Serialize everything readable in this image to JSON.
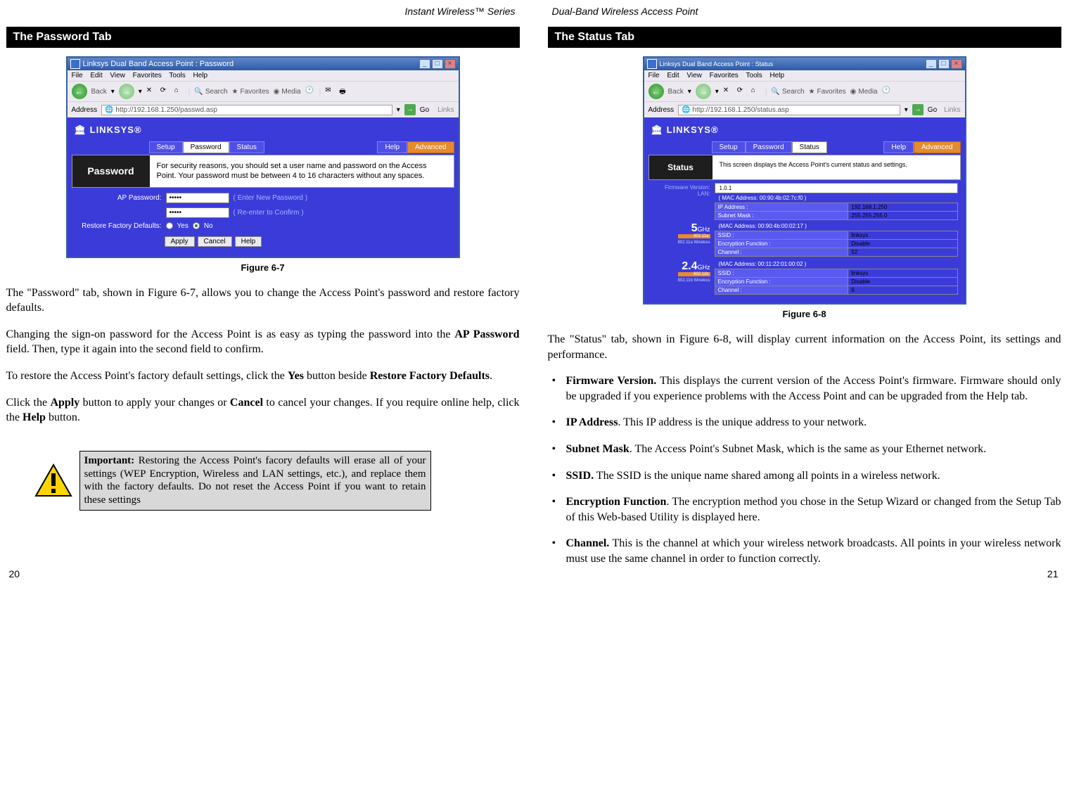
{
  "left_page": {
    "running_head": "Instant Wireless™ Series",
    "section_title": "The Password Tab",
    "figure_caption": "Figure 6-7",
    "page_number": "20",
    "browser": {
      "title": "Linksys Dual Band Access Point : Password",
      "menu": "File   Edit   View   Favorites   Tools   Help",
      "btn_back": "Back",
      "btn_search": "Search",
      "btn_favorites": "Favorites",
      "btn_media": "Media",
      "addr_label": "Address",
      "addr_value": "http://192.168.1.250/passwd.asp",
      "go": "Go",
      "links": "Links",
      "brand": "LINKSYS®",
      "tab_setup": "Setup",
      "tab_password": "Password",
      "tab_status": "Status",
      "tab_help": "Help",
      "tab_advanced": "Advanced",
      "side_label": "Password",
      "desc": "For security reasons, you should set a user name and password on the Access Point. Your password must be between 4 to 16 characters without any spaces.",
      "row_ap_password": "AP Password:",
      "pw_value": "•••••",
      "hint_enter": "( Enter New Password )",
      "hint_confirm": "( Re-enter to Confirm )",
      "row_restore": "Restore Factory Defaults:",
      "radio_yes": "Yes",
      "radio_no": "No",
      "btn_apply": "Apply",
      "btn_cancel": "Cancel",
      "btn_help": "Help"
    },
    "para1a": "The \"Password\" tab, shown in Figure 6-7, allows you to change the Access Point's password and restore factory defaults.",
    "para2_pre": "Changing the sign-on password for the Access Point is as easy as typing the password into the ",
    "para2_bold": "AP Password",
    "para2_post": " field. Then, type it again into the second field to confirm.",
    "para3_pre": "To restore the Access Point's factory default settings, click the ",
    "para3_b1": "Yes",
    "para3_mid": " button beside ",
    "para3_b2": "Restore Factory Defaults",
    "para3_post": ".",
    "para4_pre": "Click the ",
    "para4_b1": "Apply",
    "para4_mid1": " button to apply your changes or ",
    "para4_b2": "Cancel",
    "para4_mid2": " to cancel your changes. If you require online help, click the ",
    "para4_b3": "Help",
    "para4_post": " button.",
    "warn_bold": "Important:",
    "warn_text": " Restoring the Access Point's facory defaults will erase all of your settings (WEP Encryption, Wireless and LAN settings, etc.), and replace them with the factory defaults. Do not reset the Access Point if you want to retain these settings"
  },
  "right_page": {
    "running_head": "Dual-Band Wireless Access Point",
    "section_title": "The Status Tab",
    "figure_caption": "Figure 6-8",
    "page_number": "21",
    "browser": {
      "title": "Linksys Dual Band Access Point : Status",
      "menu": "File   Edit   View   Favorites   Tools   Help",
      "btn_back": "Back",
      "btn_search": "Search",
      "btn_favorites": "Favorites",
      "btn_media": "Media",
      "addr_label": "Address",
      "addr_value": "http://192.168.1.250/status.asp",
      "go": "Go",
      "links": "Links",
      "brand": "LINKSYS®",
      "tab_setup": "Setup",
      "tab_password": "Password",
      "tab_status": "Status",
      "tab_help": "Help",
      "tab_advanced": "Advanced",
      "side_label": "Status",
      "desc": "This screen displays the Access Point's current status and settings.",
      "fw_label": "Firmware Version:",
      "fw_value": "1.0.1",
      "lan_label": "LAN:",
      "lan_mac": "( MAC Address: 00:90:4b:02:7c:f0 )",
      "lan_ip_k": "IP Address :",
      "lan_ip_v": "192.168.1.250",
      "lan_mask_k": "Subnet Mask :",
      "lan_mask_v": "255.255.255.0",
      "ghz5_num": "5",
      "ghz5_unit": "GHz",
      "ghz5_std": "802.11a",
      "ghz5_band": "802.11a Wireless",
      "w5_mac": "(MAC Address: 00:90:4b:00:02:17 )",
      "w5_ssid_k": "SSID :",
      "w5_ssid_v": "linksys",
      "w5_enc_k": "Encryption Function :",
      "w5_enc_v": "Disable",
      "w5_ch_k": "Channel :",
      "w5_ch_v": "52",
      "ghz24_num": "2.4",
      "ghz24_unit": "GHz",
      "ghz24_std": "802.11b",
      "ghz24_band": "802.11b Wireless",
      "w24_mac": "(MAC Address: 00:11:22:01:00:02 )",
      "w24_ssid_k": "SSID :",
      "w24_ssid_v": "linksys",
      "w24_enc_k": "Encryption Function :",
      "w24_enc_v": "Disable",
      "w24_ch_k": "Channel :",
      "w24_ch_v": "6"
    },
    "para1": "The \"Status\" tab, shown in Figure 6-8, will display current information on the Access Point, its settings and performance.",
    "bul1_b": "Firmware Version.",
    "bul1_t": " This displays the current version of the Access Point's firmware. Firmware should only be upgraded if you experience problems with the Access Point and can be upgraded from the Help tab.",
    "bul2_b": "IP Address",
    "bul2_t": ". This IP address is the unique address to your network.",
    "bul3_b": "Subnet Mask",
    "bul3_t": ". The Access Point's Subnet Mask, which is the same as your Ethernet network.",
    "bul4_b": "SSID.",
    "bul4_t": " The SSID is the unique name shared among all points in a wireless network.",
    "bul5_b": "Encryption Function",
    "bul5_t": ". The encryption method you chose in the Setup Wizard or changed from the Setup Tab of this Web-based Utility is displayed here.",
    "bul6_b": "Channel.",
    "bul6_t": "  This is the channel at which your wireless network broadcasts. All points in your wireless network must use the same channel in order to function correctly."
  }
}
